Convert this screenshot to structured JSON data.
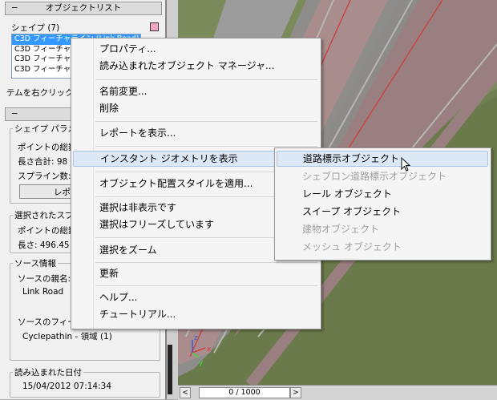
{
  "panel": {
    "object_list_header": "オブジェクトリスト",
    "shapes_label": "シェイプ (7)",
    "shape_items": [
      "C3D フィーチャライン (Link Road)",
      "C3D フィーチャ",
      "C3D フィーチャ",
      "C3D フィーチャ"
    ],
    "right_click_hint": "テムを右クリックし",
    "shape_rollout_header": "シェイ",
    "shape_params_group": "シェイプ パラメ",
    "point_total_1": "ポイントの総数",
    "length_total": "長さ合計: 98",
    "spline_count": "スプライン数:",
    "report_button": "レポ",
    "selected_group": "選択されたスプ",
    "point_total_2": "ポイントの総数",
    "selected_length": "長さ: 496.45",
    "source_group": "ソース情報",
    "source_parent_label": "ソースの親名:",
    "source_parent_value": "Link Road",
    "source_feature_label": "ソースのフィー",
    "source_feature_value": "Cyclepathin - 領域 (1)",
    "loaded_date_label": "読み込まれた日付",
    "loaded_date_value": "15/04/2012 07:14:34",
    "collapse_symbol": "−"
  },
  "timebar": {
    "frame": "0 / 1000",
    "prev": "<",
    "next": ">"
  },
  "viewport": {
    "axis_z": "z",
    "axis_x": "x",
    "axis_y": "y"
  },
  "context_menu": {
    "items": [
      "プロパティ...",
      "読み込まれたオブジェクト マネージャ...",
      "名前変更...",
      "削除",
      "レポートを表示...",
      "インスタント ジオメトリを表示",
      "オブジェクト配置スタイルを適用...",
      "選択は非表示です",
      "選択はフリーズしています",
      "選択をズーム",
      "更新",
      "ヘルプ...",
      "チュートリアル..."
    ],
    "submenu_arrow": "▶"
  },
  "submenu": {
    "items": [
      "道路標示オブジェクト",
      "シェブロン道路標示オブジェクト",
      "レール オブジェクト",
      "スイープ オブジェクト",
      "建物オブジェクト",
      "メッシュ オブジェクト"
    ]
  },
  "colors": {
    "highlight": "#dce8f6",
    "selection": "#3399ff",
    "disabled_text": "#a0a0a0"
  }
}
